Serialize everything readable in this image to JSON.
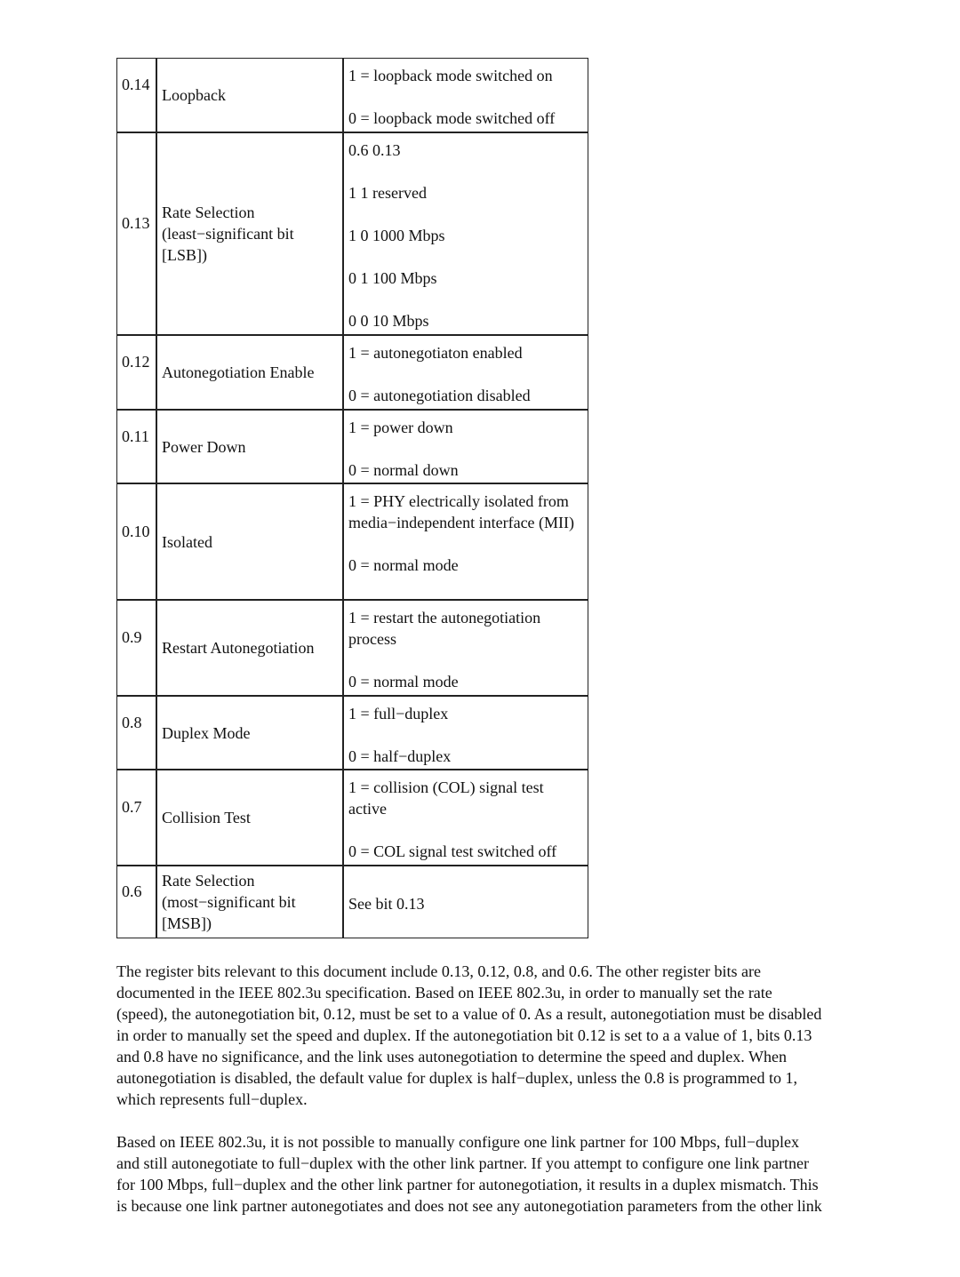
{
  "rows": [
    {
      "bit": "0.14",
      "name": "Loopback",
      "values": [
        "1 = loopback mode switched on",
        "0 = loopback mode switched off"
      ]
    },
    {
      "bit": "0.13",
      "name": "Rate Selection (least−significant bit [LSB])",
      "values": [
        "0.6 0.13",
        "1 1 reserved",
        "1 0 1000 Mbps",
        "0 1 100 Mbps",
        "0 0 10 Mbps"
      ]
    },
    {
      "bit": "0.12",
      "name": "Autonegotiation Enable",
      "values": [
        "1 = autonegotiaton enabled",
        "0 = autonegotiation disabled"
      ]
    },
    {
      "bit": "0.11",
      "name": "Power Down",
      "values": [
        "1 = power down",
        "0 = normal down"
      ]
    },
    {
      "bit": "0.10",
      "name": "Isolated",
      "values": [
        "1 = PHY electrically isolated from media−independent interface (MII)",
        "0 = normal mode"
      ]
    },
    {
      "bit": "0.9",
      "name": "Restart Autonegotiation",
      "values": [
        "1 = restart the autonegotiation process",
        "0 = normal mode"
      ]
    },
    {
      "bit": "0.8",
      "name": "Duplex Mode",
      "values": [
        "1 = full−duplex",
        "0 = half−duplex"
      ]
    },
    {
      "bit": "0.7",
      "name": "Collision Test",
      "values": [
        "1 = collision (COL) signal test active",
        "0 = COL signal test switched off"
      ]
    },
    {
      "bit": "0.6",
      "name": "Rate Selection (most−significant bit [MSB])",
      "values": [
        "See bit 0.13"
      ]
    }
  ],
  "paragraphs": [
    [
      "The register bits relevant to this document include 0.13, 0.12, 0.8, and 0.6. The other register bits are",
      "documented in the IEEE 802.3u specification. Based on IEEE 802.3u, in order to manually set the rate",
      "(speed), the autonegotiation bit, 0.12, must be set to a value of 0. As a result, autonegotiation must be disabled",
      "in order to manually set the speed and duplex. If the autonegotiation bit 0.12 is set to a a value of 1, bits 0.13",
      "and 0.8 have no significance, and the link uses autonegotiation to determine the speed and duplex. When",
      "autonegotiation is disabled, the default value for duplex is half−duplex, unless the 0.8 is programmed to 1,",
      "which represents full−duplex."
    ],
    [
      "Based on IEEE 802.3u, it is not possible to manually configure one link partner for 100 Mbps, full−duplex",
      "and still autonegotiate to full−duplex with the other link partner. If you attempt to configure one link partner",
      "for 100 Mbps, full−duplex and the other link partner for autonegotiation, it results in a duplex mismatch. This",
      "is because one link partner autonegotiates and does not see any autonegotiation parameters from the other link"
    ]
  ]
}
